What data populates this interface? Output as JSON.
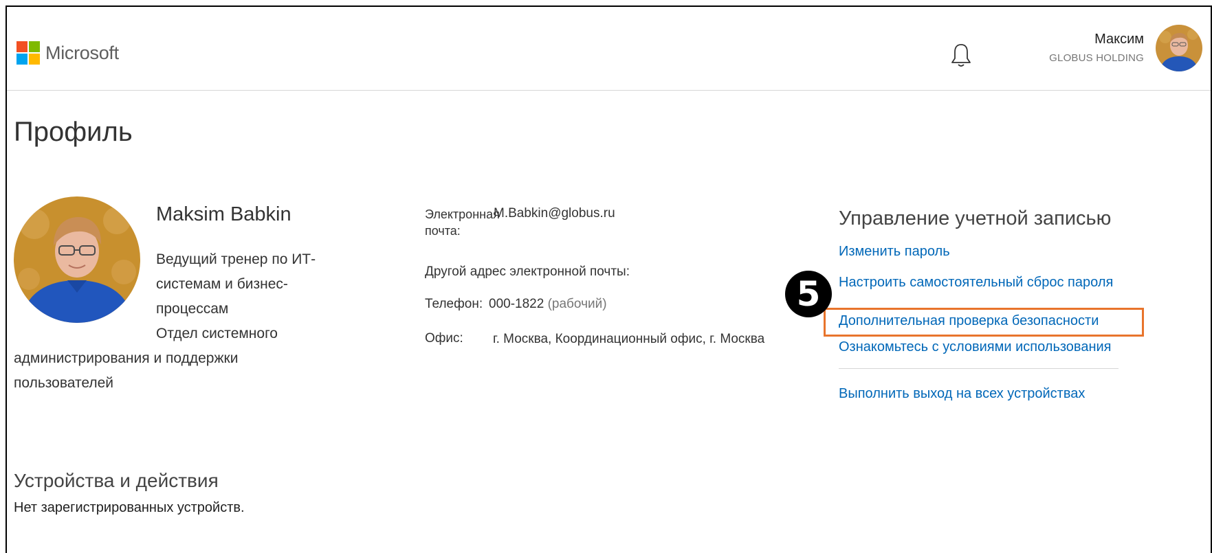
{
  "header": {
    "logo_text": "Microsoft",
    "logo_colors": [
      "#f25022",
      "#7fba00",
      "#00a4ef",
      "#ffb900"
    ],
    "notifications_icon": "bell-icon",
    "user_name": "Максим",
    "user_org": "GLOBUS HOLDING"
  },
  "page": {
    "title": "Профиль"
  },
  "profile": {
    "full_name": "Maksim Babkin",
    "job_title": "Ведущий тренер по ИТ-системам и бизнес-процессам",
    "department": "Отдел системного администрирования и поддержки пользователей"
  },
  "contact": {
    "email_label": "Электронная почта:",
    "email_value": "M.Babkin@globus.ru",
    "alt_email_label": "Другой адрес электронной почты:",
    "alt_email_value": "",
    "phone_label": "Телефон:",
    "phone_value": "000-1822",
    "phone_type": "(рабочий)",
    "office_label": "Офис:",
    "office_value": "г. Москва, Координационный офис, г. Москва"
  },
  "account": {
    "title": "Управление учетной записью",
    "links": [
      "Изменить пароль",
      "Настроить самостоятельный сброс пароля",
      "Дополнительная проверка безопасности",
      "Ознакомьтесь с условиями использования"
    ],
    "signout": "Выполнить выход на всех устройствах",
    "step_badge": "5",
    "highlight_color": "#e8742c",
    "link_color": "#0067b8"
  },
  "devices": {
    "title": "Устройства и действия",
    "empty_text": "Нет зарегистрированных устройств."
  }
}
